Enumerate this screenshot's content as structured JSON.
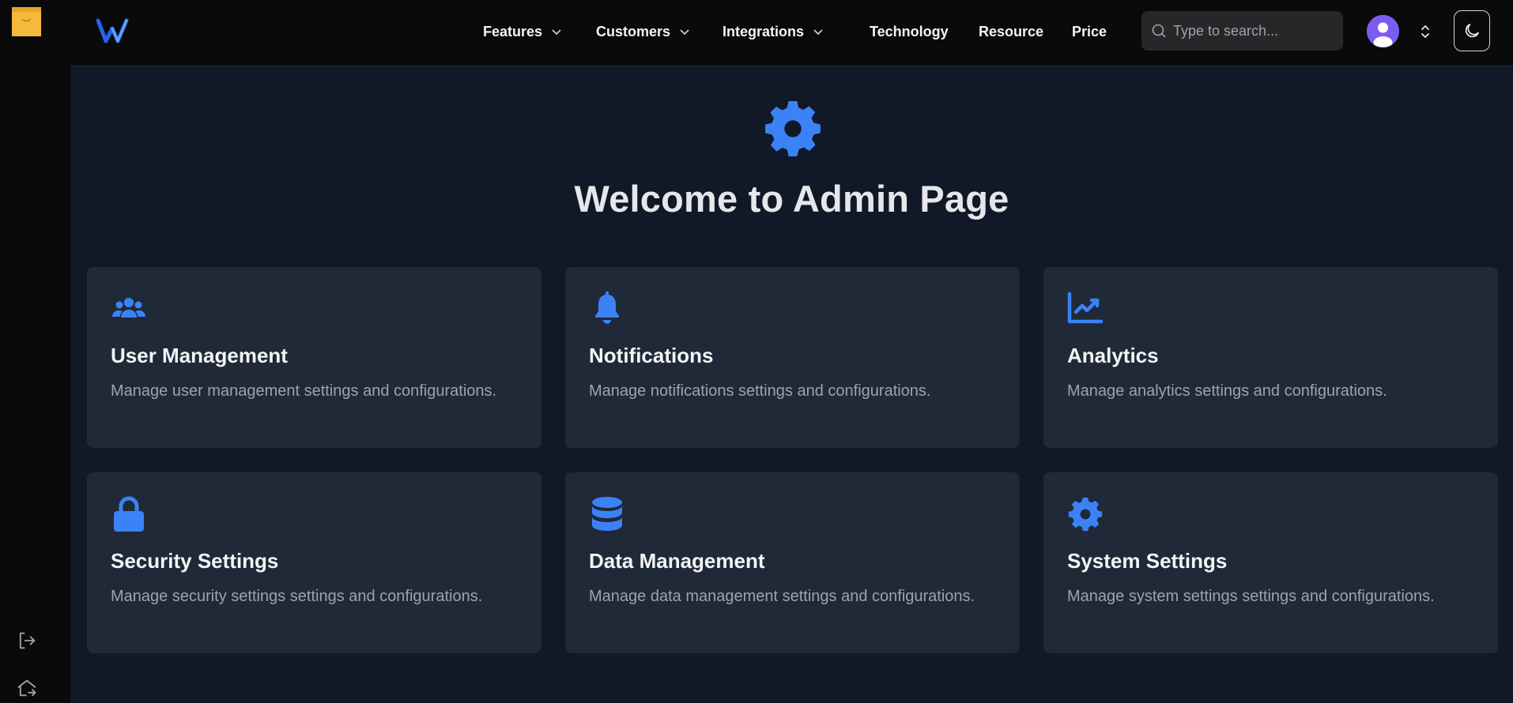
{
  "nav": {
    "items": [
      {
        "label": "Features",
        "dropdown": true
      },
      {
        "label": "Customers",
        "dropdown": true
      },
      {
        "label": "Integrations",
        "dropdown": true
      },
      {
        "label": "Technology",
        "dropdown": false
      },
      {
        "label": "Resource",
        "dropdown": false
      },
      {
        "label": "Price",
        "dropdown": false
      }
    ],
    "search": {
      "placeholder": "Type to search...",
      "value": ""
    }
  },
  "main": {
    "hero_icon": "gear-icon",
    "title": "Welcome to Admin Page",
    "cards": [
      {
        "icon": "users-icon",
        "title": "User Management",
        "desc": "Manage user management settings and configurations."
      },
      {
        "icon": "bell-icon",
        "title": "Notifications",
        "desc": "Manage notifications settings and configurations."
      },
      {
        "icon": "chart-line-icon",
        "title": "Analytics",
        "desc": "Manage analytics settings and configurations."
      },
      {
        "icon": "lock-icon",
        "title": "Security Settings",
        "desc": "Manage security settings settings and configurations."
      },
      {
        "icon": "database-icon",
        "title": "Data Management",
        "desc": "Manage data management settings and configurations."
      },
      {
        "icon": "gear-icon",
        "title": "System Settings",
        "desc": "Manage system settings settings and configurations."
      }
    ]
  },
  "colors": {
    "accent": "#3b82f6",
    "background": "#111827",
    "card": "#1f2937",
    "topbar": "#0a0a0a",
    "avatar": "#7c5cf0",
    "rail_logo": "#f5b93b"
  }
}
